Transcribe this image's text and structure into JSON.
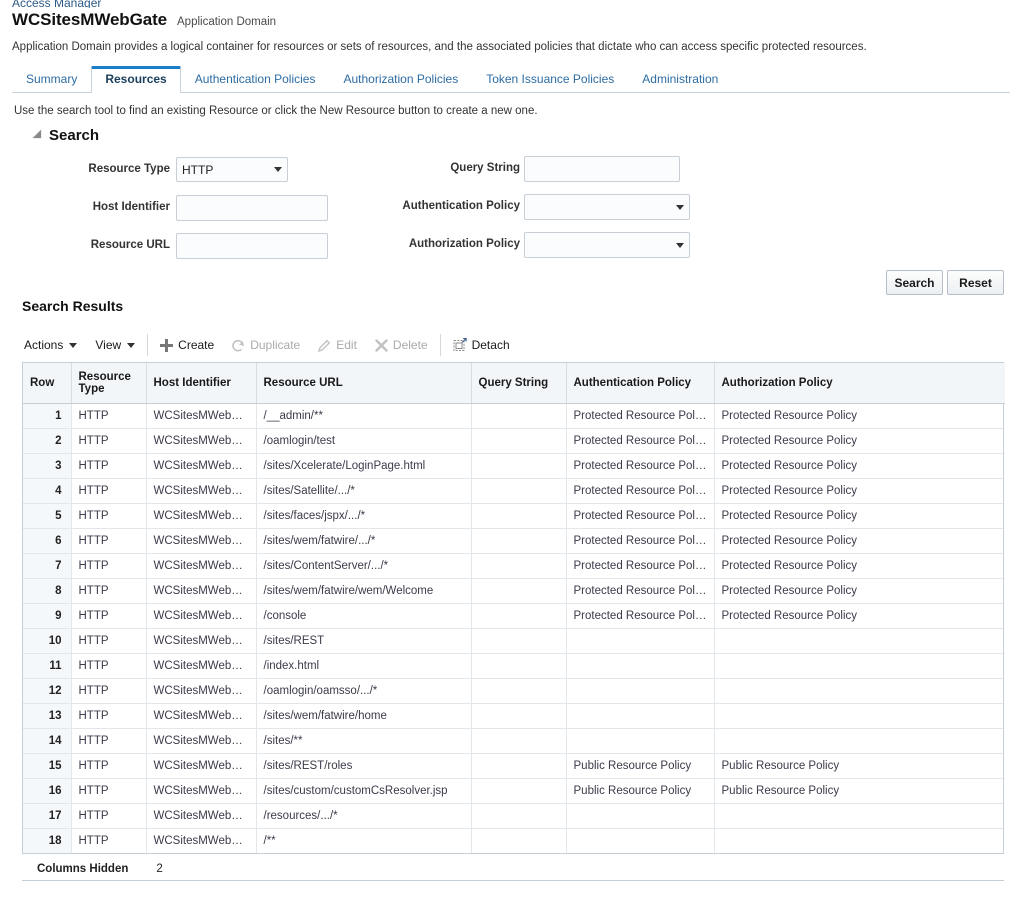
{
  "header": {
    "breadcrumb": "Access Manager",
    "title": "WCSitesMWebGate",
    "subtitle": "Application Domain",
    "description": "Application Domain provides a logical container for resources or sets of resources, and the associated policies that dictate who can access specific protected resources."
  },
  "tabs": [
    {
      "label": "Summary",
      "active": false
    },
    {
      "label": "Resources",
      "active": true
    },
    {
      "label": "Authentication Policies",
      "active": false
    },
    {
      "label": "Authorization Policies",
      "active": false
    },
    {
      "label": "Token Issuance Policies",
      "active": false
    },
    {
      "label": "Administration",
      "active": false
    }
  ],
  "hint": "Use the search tool to find an existing Resource or click the New Resource button to create a new one.",
  "search": {
    "section_title": "Search",
    "fields": {
      "resource_type_label": "Resource Type",
      "resource_type_value": "HTTP",
      "host_identifier_label": "Host Identifier",
      "host_identifier_value": "",
      "resource_url_label": "Resource URL",
      "resource_url_value": "",
      "query_string_label": "Query String",
      "query_string_value": "",
      "authentication_policy_label": "Authentication Policy",
      "authentication_policy_value": "",
      "authorization_policy_label": "Authorization Policy",
      "authorization_policy_value": ""
    },
    "search_button": "Search",
    "reset_button": "Reset"
  },
  "results": {
    "title": "Search Results",
    "toolbar": {
      "actions": "Actions",
      "view": "View",
      "create": "Create",
      "duplicate": "Duplicate",
      "edit": "Edit",
      "delete": "Delete",
      "detach": "Detach"
    },
    "columns": [
      "Row",
      "Resource Type",
      "Host Identifier",
      "Resource URL",
      "Query String",
      "Authentication Policy",
      "Authorization Policy"
    ],
    "rows": [
      {
        "row": "1",
        "type": "HTTP",
        "host": "WCSitesMWebGate",
        "url": "/__admin/**",
        "query": "",
        "authn": "Protected Resource Policy",
        "authz": "Protected Resource Policy"
      },
      {
        "row": "2",
        "type": "HTTP",
        "host": "WCSitesMWebGate",
        "url": "/oamlogin/test",
        "query": "",
        "authn": "Protected Resource Policy",
        "authz": "Protected Resource Policy"
      },
      {
        "row": "3",
        "type": "HTTP",
        "host": "WCSitesMWebGate",
        "url": "/sites/Xcelerate/LoginPage.html",
        "query": "",
        "authn": "Protected Resource Policy",
        "authz": "Protected Resource Policy"
      },
      {
        "row": "4",
        "type": "HTTP",
        "host": "WCSitesMWebGate",
        "url": "/sites/Satellite/.../*",
        "query": "",
        "authn": "Protected Resource Policy",
        "authz": "Protected Resource Policy"
      },
      {
        "row": "5",
        "type": "HTTP",
        "host": "WCSitesMWebGate",
        "url": "/sites/faces/jspx/.../*",
        "query": "",
        "authn": "Protected Resource Policy",
        "authz": "Protected Resource Policy"
      },
      {
        "row": "6",
        "type": "HTTP",
        "host": "WCSitesMWebGate",
        "url": "/sites/wem/fatwire/.../*",
        "query": "",
        "authn": "Protected Resource Policy",
        "authz": "Protected Resource Policy"
      },
      {
        "row": "7",
        "type": "HTTP",
        "host": "WCSitesMWebGate",
        "url": "/sites/ContentServer/.../*",
        "query": "",
        "authn": "Protected Resource Policy",
        "authz": "Protected Resource Policy"
      },
      {
        "row": "8",
        "type": "HTTP",
        "host": "WCSitesMWebGate",
        "url": "/sites/wem/fatwire/wem/Welcome",
        "query": "",
        "authn": "Protected Resource Policy",
        "authz": "Protected Resource Policy"
      },
      {
        "row": "9",
        "type": "HTTP",
        "host": "WCSitesMWebGate",
        "url": "/console",
        "query": "",
        "authn": "Protected Resource Policy",
        "authz": "Protected Resource Policy"
      },
      {
        "row": "10",
        "type": "HTTP",
        "host": "WCSitesMWebGate",
        "url": "/sites/REST",
        "query": "",
        "authn": "",
        "authz": ""
      },
      {
        "row": "11",
        "type": "HTTP",
        "host": "WCSitesMWebGate",
        "url": "/index.html",
        "query": "",
        "authn": "",
        "authz": ""
      },
      {
        "row": "12",
        "type": "HTTP",
        "host": "WCSitesMWebGate",
        "url": "/oamlogin/oamsso/.../*",
        "query": "",
        "authn": "",
        "authz": ""
      },
      {
        "row": "13",
        "type": "HTTP",
        "host": "WCSitesMWebGate",
        "url": "/sites/wem/fatwire/home",
        "query": "",
        "authn": "",
        "authz": ""
      },
      {
        "row": "14",
        "type": "HTTP",
        "host": "WCSitesMWebGate",
        "url": "/sites/**",
        "query": "",
        "authn": "",
        "authz": ""
      },
      {
        "row": "15",
        "type": "HTTP",
        "host": "WCSitesMWebGate",
        "url": "/sites/REST/roles",
        "query": "",
        "authn": "Public Resource Policy",
        "authz": "Public Resource Policy"
      },
      {
        "row": "16",
        "type": "HTTP",
        "host": "WCSitesMWebGate",
        "url": "/sites/custom/customCsResolver.jsp",
        "query": "",
        "authn": "Public Resource Policy",
        "authz": "Public Resource Policy"
      },
      {
        "row": "17",
        "type": "HTTP",
        "host": "WCSitesMWebGate",
        "url": "/resources/.../*",
        "query": "",
        "authn": "",
        "authz": ""
      },
      {
        "row": "18",
        "type": "HTTP",
        "host": "WCSitesMWebGate",
        "url": "/**",
        "query": "",
        "authn": "",
        "authz": ""
      }
    ],
    "footer": {
      "columns_hidden_label": "Columns Hidden",
      "columns_hidden_count": "2"
    }
  },
  "colors": {
    "accent": "#1a7ec8",
    "link": "#2d6ca2",
    "header_bg": "#f3f6f9",
    "rownum_bg": "#f5f8fb",
    "border": "#c6ced6"
  }
}
